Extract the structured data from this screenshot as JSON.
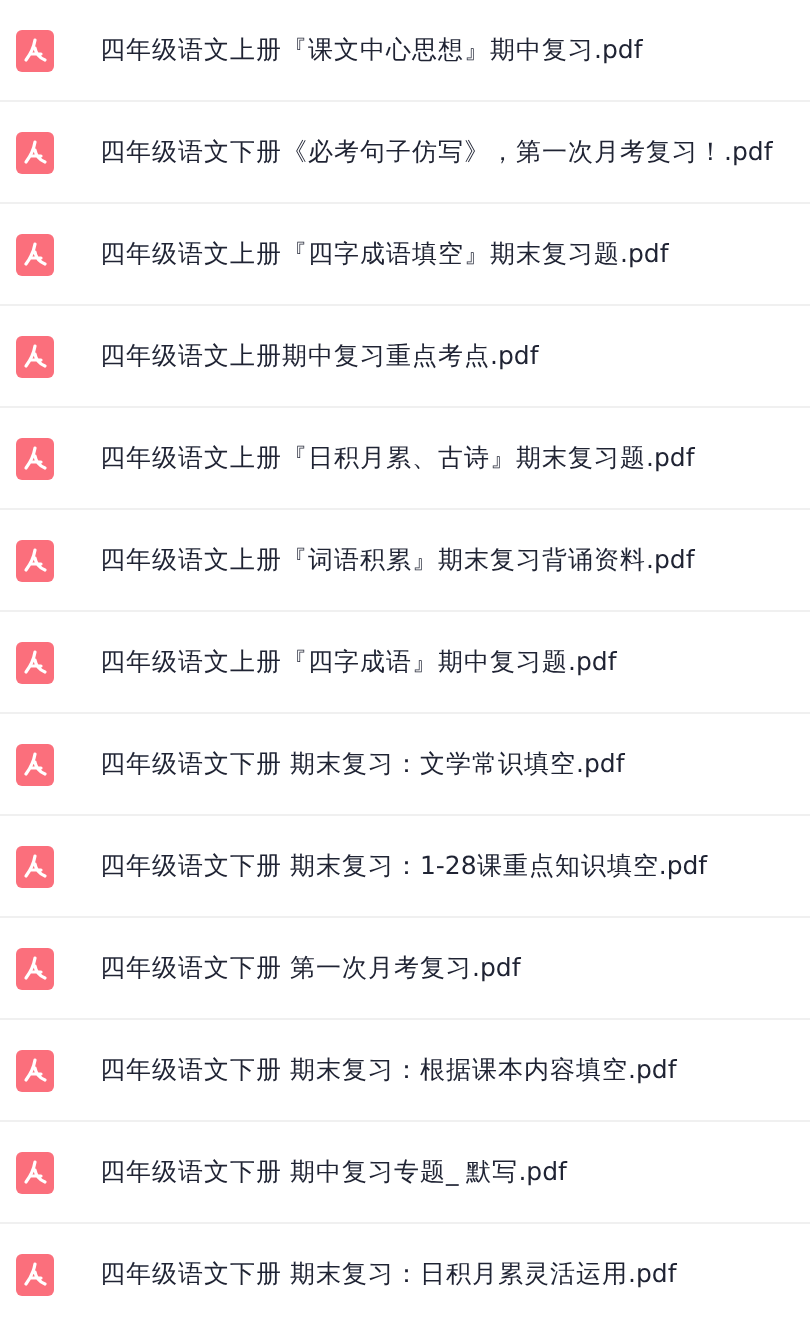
{
  "files": [
    {
      "name": "四年级语文上册『课文中心思想』期中复习.pdf"
    },
    {
      "name": "四年级语文下册《必考句子仿写》，第一次月考复习！.pdf"
    },
    {
      "name": "四年级语文上册『四字成语填空』期末复习题.pdf"
    },
    {
      "name": "四年级语文上册期中复习重点考点.pdf"
    },
    {
      "name": "四年级语文上册『日积月累、古诗』期末复习题.pdf"
    },
    {
      "name": "四年级语文上册『词语积累』期末复习背诵资料.pdf"
    },
    {
      "name": "四年级语文上册『四字成语』期中复习题.pdf"
    },
    {
      "name": "四年级语文下册 期末复习：文学常识填空.pdf"
    },
    {
      "name": "四年级语文下册 期末复习：1-28课重点知识填空.pdf"
    },
    {
      "name": "四年级语文下册 第一次月考复习.pdf"
    },
    {
      "name": "四年级语文下册 期末复习：根据课本内容填空.pdf"
    },
    {
      "name": "四年级语文下册 期中复习专题_ 默写.pdf"
    },
    {
      "name": "四年级语文下册 期末复习：日积月累灵活运用.pdf"
    }
  ]
}
